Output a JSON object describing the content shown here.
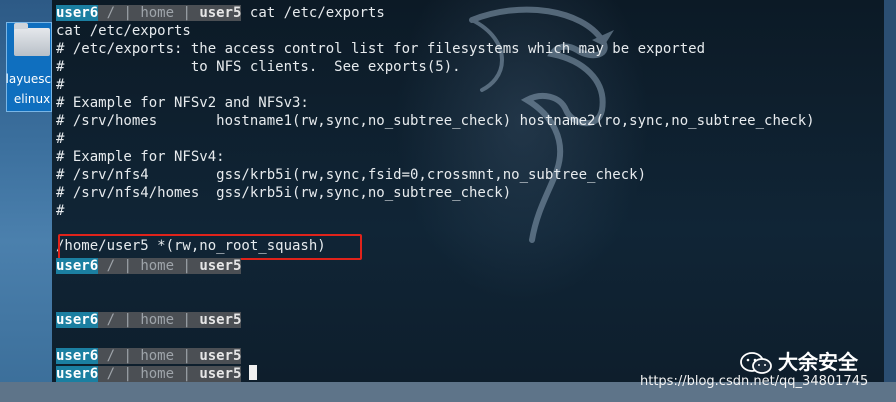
{
  "desktop": {
    "icon_name": "folder-icon",
    "label_line1": "layuesca",
    "label_line2": "elinux"
  },
  "terminal": {
    "prompt": {
      "user": "user6",
      "sep1": " / | ",
      "dir": "home",
      "sep2": " | ",
      "host": "user5"
    },
    "command": "cat /etc/exports",
    "output": [
      "cat /etc/exports",
      "# /etc/exports: the access control list for filesystems which may be exported",
      "#               to NFS clients.  See exports(5).",
      "#",
      "# Example for NFSv2 and NFSv3:",
      "# /srv/homes       hostname1(rw,sync,no_subtree_check) hostname2(ro,sync,no_subtree_check)",
      "#",
      "# Example for NFSv4:",
      "# /srv/nfs4        gss/krb5i(rw,sync,fsid=0,crossmnt,no_subtree_check)",
      "# /srv/nfs4/homes  gss/krb5i(rw,sync,no_subtree_check)",
      "#",
      "",
      "/home/user5 *(rw,no_root_squash)"
    ],
    "highlight_color": "#e0231b"
  },
  "watermark": {
    "title": "大余安全",
    "url": "https://blog.csdn.net/qq_34801745"
  },
  "colors": {
    "prompt_user_bg": "#1b7fa1",
    "prompt_mid_bg": "#4b4f54",
    "terminal_bg": "#0c1a26"
  }
}
